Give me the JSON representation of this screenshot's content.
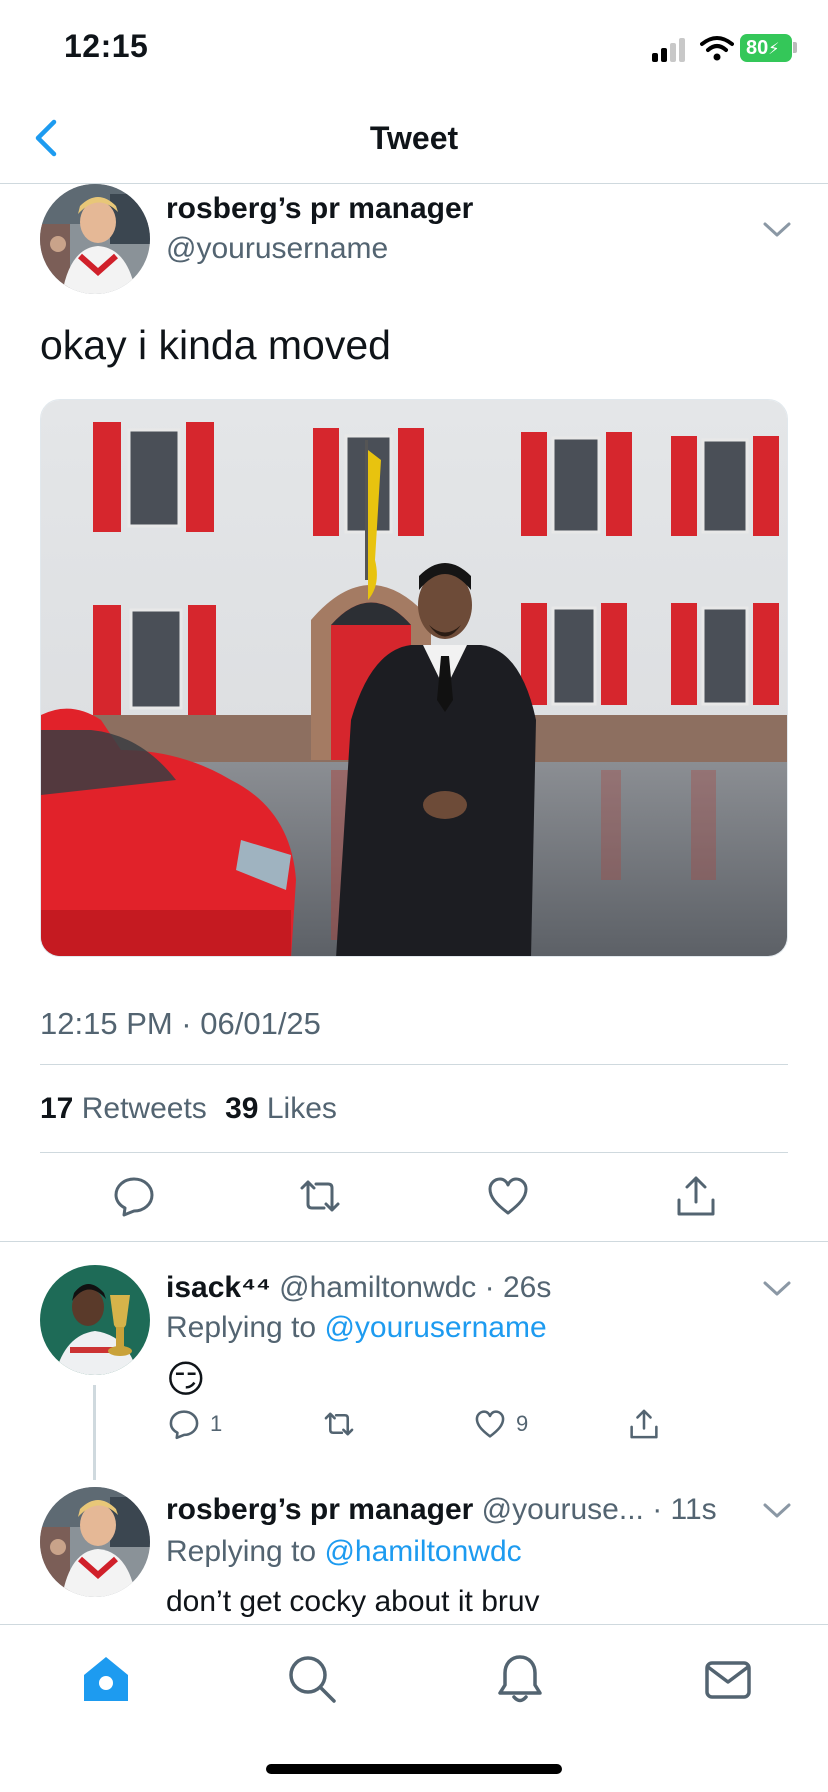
{
  "status_bar": {
    "time": "12:15",
    "battery": "80"
  },
  "header": {
    "title": "Tweet"
  },
  "main_tweet": {
    "display_name": "rosberg’s pr manager",
    "handle": "@yourusername",
    "text": "okay i kinda moved",
    "timestamp": "12:15 PM · 06/01/25",
    "retweets_count": "17",
    "retweets_label": "Retweets",
    "likes_count": "39",
    "likes_label": "Likes"
  },
  "reply1": {
    "display_name": "isack⁴⁴",
    "handle": "@hamiltonwdc",
    "time": "· 26s",
    "replying_prefix": "Replying to",
    "replying_to": "@yourusername",
    "text": "😏",
    "reply_count": "1",
    "like_count": "9"
  },
  "reply2": {
    "display_name": "rosberg’s pr manager",
    "handle": "@youruse...",
    "time": "· 11s",
    "replying_prefix": "Replying to",
    "replying_to": "@hamiltonwdc",
    "text": "don’t get cocky about it bruv"
  },
  "colors": {
    "accent": "#1d9bf0",
    "battery": "#34c759",
    "secondary_text": "#536471",
    "divider": "#cfd9de"
  },
  "tab_bar": {
    "tabs": [
      "home-icon",
      "search-icon",
      "notifications-icon",
      "messages-icon"
    ]
  }
}
